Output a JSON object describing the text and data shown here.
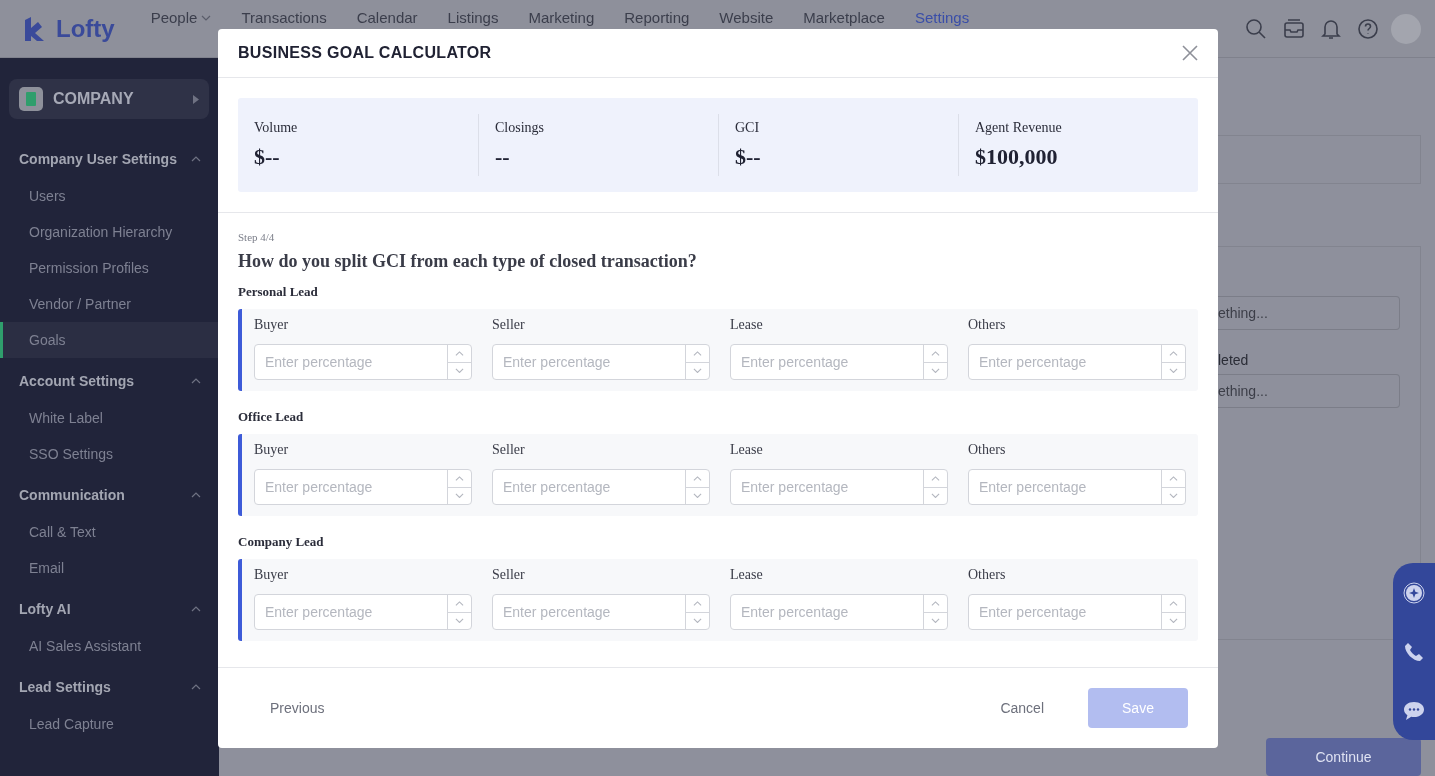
{
  "app": {
    "logo": "Lofty",
    "nav": [
      {
        "label": "People",
        "has_menu": true,
        "selected": false
      },
      {
        "label": "Transactions",
        "has_menu": false,
        "selected": false
      },
      {
        "label": "Calendar",
        "has_menu": false,
        "selected": false
      },
      {
        "label": "Listings",
        "has_menu": false,
        "selected": false
      },
      {
        "label": "Marketing",
        "has_menu": false,
        "selected": false
      },
      {
        "label": "Reporting",
        "has_menu": false,
        "selected": false
      },
      {
        "label": "Website",
        "has_menu": false,
        "selected": false
      },
      {
        "label": "Marketplace",
        "has_menu": false,
        "selected": false
      },
      {
        "label": "Settings",
        "has_menu": false,
        "selected": true
      }
    ]
  },
  "sidebar": {
    "switcher": "COMPANY",
    "sections": [
      {
        "title": "Company User Settings",
        "expanded": true,
        "items": [
          {
            "label": "Users",
            "selected": false
          },
          {
            "label": "Organization Hierarchy",
            "selected": false
          },
          {
            "label": "Permission Profiles",
            "selected": false
          },
          {
            "label": "Vendor / Partner",
            "selected": false
          },
          {
            "label": "Goals",
            "selected": true
          }
        ]
      },
      {
        "title": "Account Settings",
        "expanded": true,
        "items": [
          {
            "label": "White Label",
            "selected": false
          },
          {
            "label": "SSO Settings",
            "selected": false
          }
        ]
      },
      {
        "title": "Communication",
        "expanded": true,
        "items": [
          {
            "label": "Call & Text",
            "selected": false
          },
          {
            "label": "Email",
            "selected": false
          }
        ]
      },
      {
        "title": "Lofty AI",
        "expanded": true,
        "items": [
          {
            "label": "AI Sales Assistant",
            "selected": false
          }
        ]
      },
      {
        "title": "Lead Settings",
        "expanded": true,
        "items": [
          {
            "label": "Lead Capture",
            "selected": false
          }
        ]
      }
    ]
  },
  "background": {
    "first_placeholder": "ething...",
    "label": "leted",
    "second_placeholder": "ething...",
    "continue_button": "Continue"
  },
  "modal": {
    "title": "BUSINESS GOAL CALCULATOR",
    "summary": [
      {
        "label": "Volume",
        "value": "$--"
      },
      {
        "label": "Closings",
        "value": "--"
      },
      {
        "label": "GCI",
        "value": "$--"
      },
      {
        "label": "Agent Revenue",
        "value": "$100,000"
      }
    ],
    "step": "Step 4/4",
    "question": "How do you split GCI from each type of closed transaction?",
    "groups": [
      {
        "title": "Personal Lead",
        "fields": [
          {
            "label": "Buyer",
            "placeholder": "Enter percentage"
          },
          {
            "label": "Seller",
            "placeholder": "Enter percentage"
          },
          {
            "label": "Lease",
            "placeholder": "Enter percentage"
          },
          {
            "label": "Others",
            "placeholder": "Enter percentage"
          }
        ]
      },
      {
        "title": "Office Lead",
        "fields": [
          {
            "label": "Buyer",
            "placeholder": "Enter percentage"
          },
          {
            "label": "Seller",
            "placeholder": "Enter percentage"
          },
          {
            "label": "Lease",
            "placeholder": "Enter percentage"
          },
          {
            "label": "Others",
            "placeholder": "Enter percentage"
          }
        ]
      },
      {
        "title": "Company Lead",
        "fields": [
          {
            "label": "Buyer",
            "placeholder": "Enter percentage"
          },
          {
            "label": "Seller",
            "placeholder": "Enter percentage"
          },
          {
            "label": "Lease",
            "placeholder": "Enter percentage"
          },
          {
            "label": "Others",
            "placeholder": "Enter percentage"
          }
        ]
      }
    ],
    "footer": {
      "previous": "Previous",
      "cancel": "Cancel",
      "save": {
        "label": "Save",
        "disabled": true
      }
    }
  }
}
